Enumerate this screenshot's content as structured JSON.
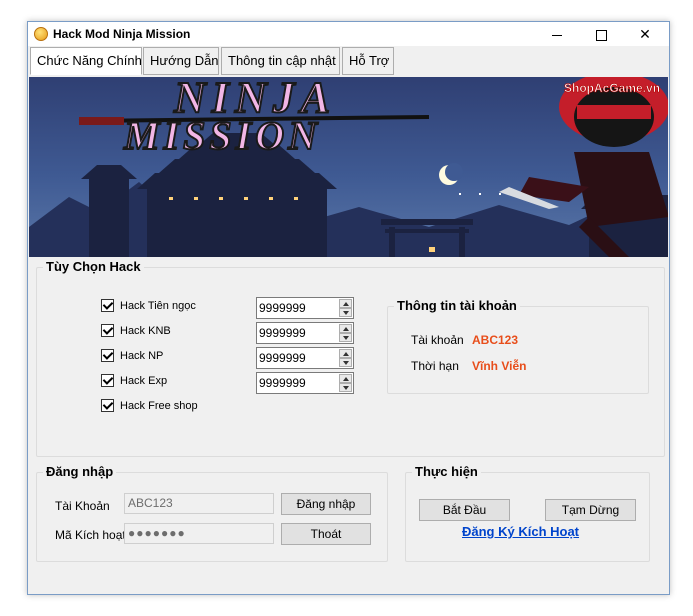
{
  "window": {
    "title": "Hack Mod Ninja Mission",
    "controls": {
      "minimize": "minimize-icon",
      "maximize": "maximize-icon",
      "close": "✕"
    }
  },
  "tabs": [
    {
      "label": "Chức Năng Chính",
      "active": true
    },
    {
      "label": "Hướng Dẫn",
      "active": false
    },
    {
      "label": "Thông tin cập nhật",
      "active": false
    },
    {
      "label": "Hỗ Trợ",
      "active": false
    }
  ],
  "banner": {
    "logo_line1": "NINJA",
    "logo_line2": "MISSION",
    "watermark": "ShopAcGame.vn"
  },
  "hack_options": {
    "title": "Tùy Chọn Hack",
    "items": [
      {
        "label": "Hack Tiên ngọc",
        "checked": true,
        "value": "9999999"
      },
      {
        "label": "Hack KNB",
        "checked": true,
        "value": "9999999"
      },
      {
        "label": "Hack NP",
        "checked": true,
        "value": "9999999"
      },
      {
        "label": "Hack Exp",
        "checked": true,
        "value": "9999999"
      },
      {
        "label": "Hack Free shop",
        "checked": true
      }
    ]
  },
  "account_info": {
    "title": "Thông tin tài khoản",
    "account_label": "Tài khoản",
    "account_value": "ABC123",
    "duration_label": "Thời hạn",
    "duration_value": "Vĩnh Viễn"
  },
  "login": {
    "title": "Đăng nhập",
    "account_label": "Tài Khoản",
    "account_value": "ABC123",
    "code_label": "Mã Kích hoạt",
    "code_value": "●●●●●●●",
    "login_button": "Đăng nhập",
    "exit_button": "Thoát"
  },
  "execute": {
    "title": "Thực hiện",
    "start_button": "Bắt Đầu",
    "pause_button": "Tạm Dừng",
    "register_link": "Đăng Ký Kích Hoạt"
  },
  "colors": {
    "accent_value": "#e84e1b",
    "link": "#0044cc",
    "logo_pink": "#f2b6e6"
  }
}
